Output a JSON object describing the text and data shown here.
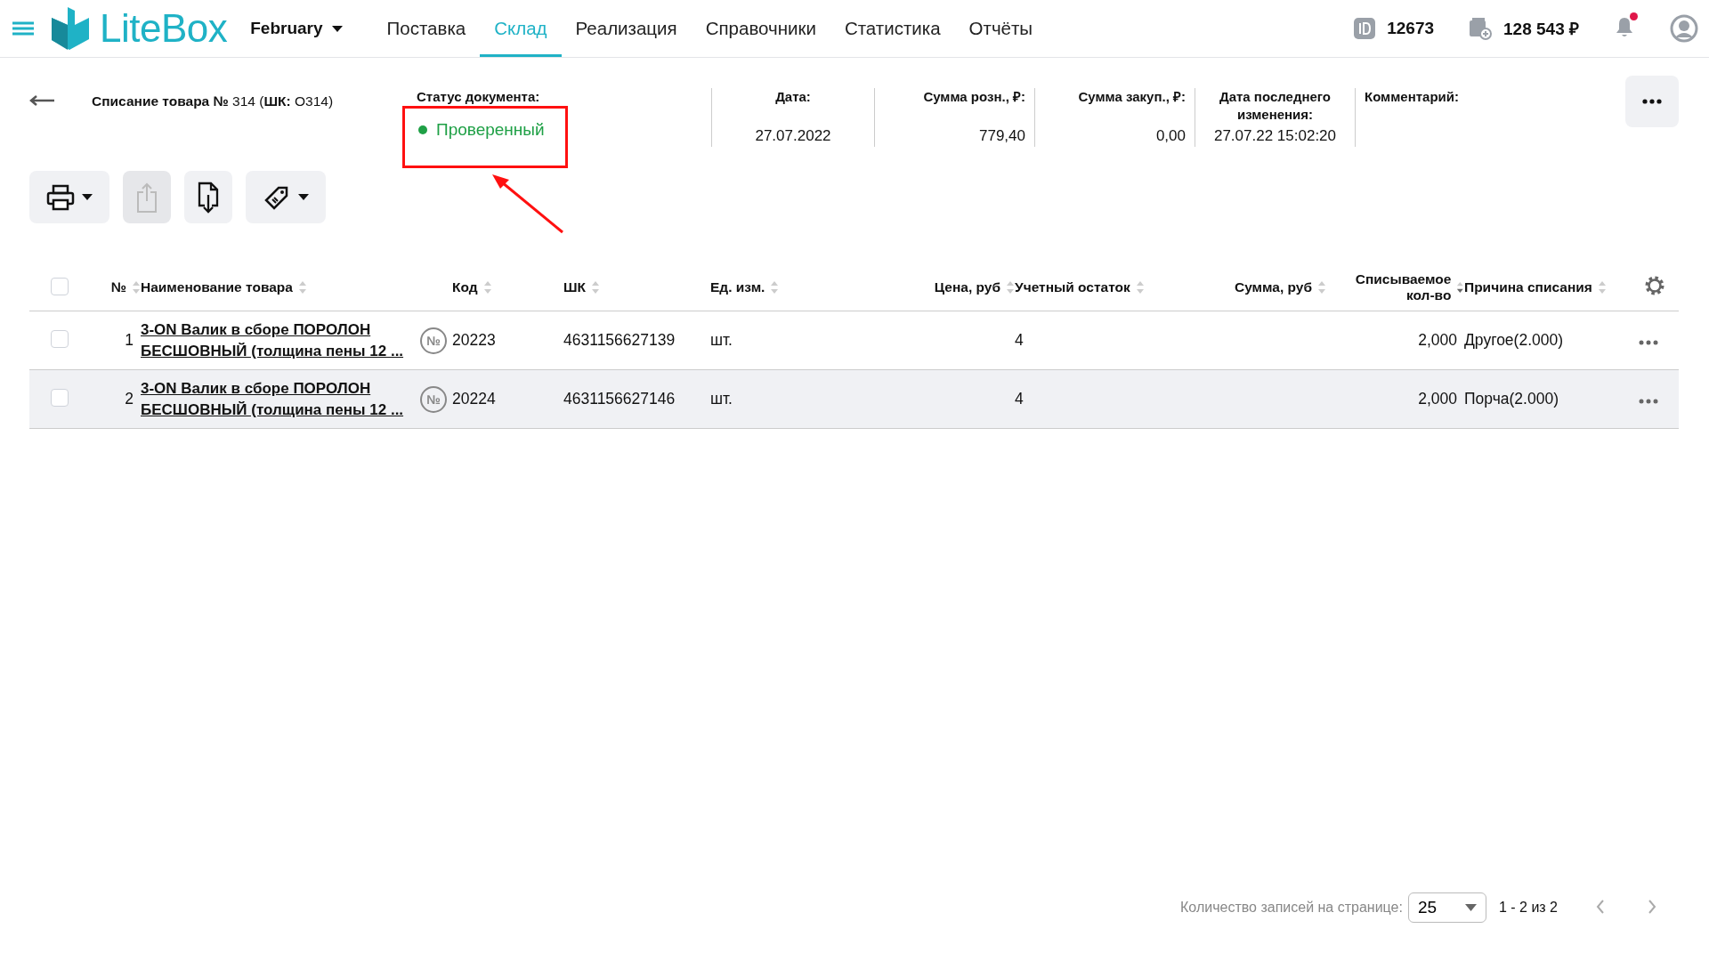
{
  "header": {
    "logo": "LiteBox",
    "store": "February",
    "nav": [
      {
        "label": "Поставка",
        "selected": false
      },
      {
        "label": "Склад",
        "selected": true
      },
      {
        "label": "Реализация",
        "selected": false
      },
      {
        "label": "Справочники",
        "selected": false
      },
      {
        "label": "Статистика",
        "selected": false
      },
      {
        "label": "Отчёты",
        "selected": false
      }
    ],
    "account_id": "12673",
    "balance": "128 543 ₽",
    "has_notifications": true
  },
  "document": {
    "title": "**Списание товара №** 314 (**ШК:** О314)",
    "fields": [
      {
        "kind": "status",
        "label": "Статус документа:",
        "value": "Проверенный",
        "color": "#1fa046"
      },
      {
        "kind": "center",
        "label": "Дата:",
        "value": "27.07.2022"
      },
      {
        "kind": "right",
        "label": "Сумма розн., ₽:",
        "value": "779,40"
      },
      {
        "kind": "right",
        "label": "Сумма закуп., ₽:",
        "value": "0,00"
      },
      {
        "kind": "center",
        "label": "Дата последнего изменения:",
        "value": "27.07.22 15:02:20"
      },
      {
        "kind": "left",
        "label": "Комментарий:"
      }
    ]
  },
  "toolbar": [
    {
      "kind": "print",
      "disabled": false,
      "menu": true
    },
    {
      "kind": "export",
      "disabled": true,
      "menu": false
    },
    {
      "kind": "import",
      "disabled": false,
      "menu": false
    },
    {
      "kind": "tag",
      "disabled": false,
      "menu": true
    }
  ],
  "table": {
    "all_checked": false,
    "columns": [
      {
        "label": "№",
        "sorted": false
      },
      {
        "label": "Наименование товара",
        "sorted": false
      },
      {
        "label": "Код",
        "sorted": false
      },
      {
        "label": "ШК",
        "sorted": false
      },
      {
        "label": "Ед. изм.",
        "sorted": false
      },
      {
        "label": "Цена, руб",
        "sorted": false
      },
      {
        "label": "Учетный остаток",
        "sorted": false
      },
      {
        "label": "Сумма, руб",
        "sorted": false
      },
      {
        "label": "Списываемое кол-во",
        "sorted": true
      },
      {
        "label": "Причина списания",
        "sorted": false
      }
    ],
    "rows": [
      {
        "checked": false,
        "hovered": false,
        "badge": "№",
        "cells": [
          "1",
          "3-ON Валик в сборе ПОРОЛОН БЕСШОВНЫЙ (толщина пены 12 ...",
          "20223",
          "4631156627139",
          "шт.",
          "",
          "4",
          "",
          "2,000",
          "Другое(2.000)"
        ]
      },
      {
        "checked": false,
        "hovered": true,
        "badge": "№",
        "cells": [
          "2",
          "3-ON Валик в сборе ПОРОЛОН БЕСШОВНЫЙ (толщина пены 12 ...",
          "20224",
          "4631156627146",
          "шт.",
          "",
          "4",
          "",
          "2,000",
          "Порча(2.000)"
        ]
      }
    ]
  },
  "pagination": {
    "label": "Количество записей на странице:",
    "page_size": "25",
    "range": "1 - 2 из 2"
  }
}
